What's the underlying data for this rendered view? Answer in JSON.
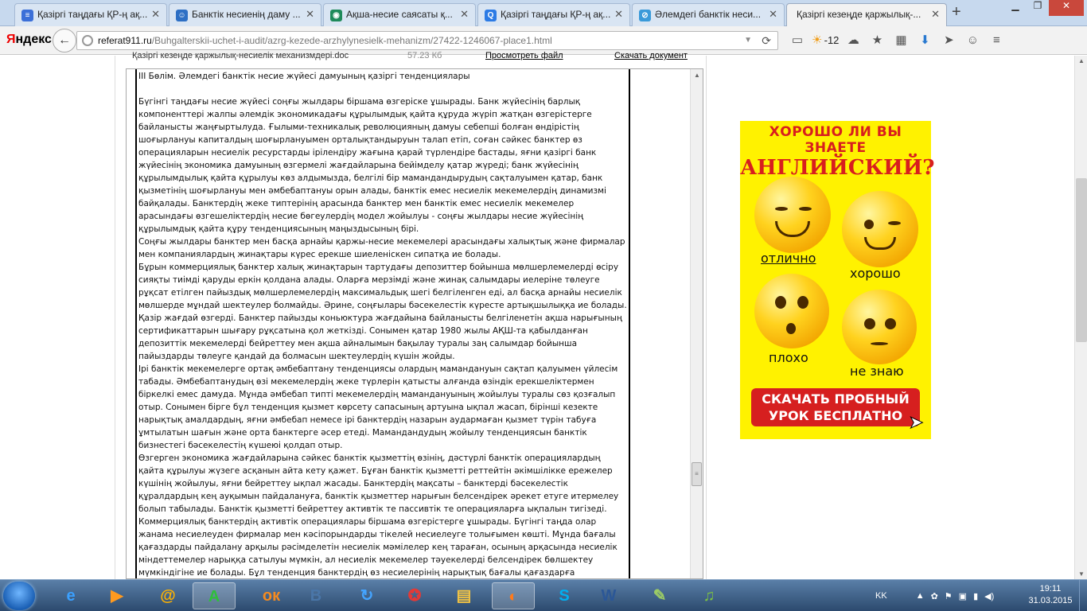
{
  "browser": {
    "tabs": [
      {
        "label": "Қазіргі таңдағы ҚР-ң ақ...",
        "icon_color": "#3b6fd8",
        "icon_glyph": "≡",
        "active": false
      },
      {
        "label": "Банктік несиенің даму ...",
        "icon_color": "#2d6fc4",
        "icon_glyph": "☺",
        "active": false
      },
      {
        "label": "Ақша-несие саясаты қ...",
        "icon_color": "#1e8a5a",
        "icon_glyph": "◉",
        "active": false
      },
      {
        "label": "Қазіргі таңдағы ҚР-ң ақ...",
        "icon_color": "#2c7be5",
        "icon_glyph": "Q",
        "active": false
      },
      {
        "label": "Әлемдегі банктік неси...",
        "icon_color": "#3a9ad9",
        "icon_glyph": "⊘",
        "active": false
      },
      {
        "label": "Қазіргі кезеңде қаржылық-...",
        "icon_color": "#ffffff",
        "icon_glyph": "",
        "active": true
      }
    ],
    "new_tab": "+",
    "logo": {
      "first": "Я",
      "rest": "ндекс"
    },
    "url": {
      "host": "referat911.ru",
      "path": "/Buhgalterskii-uchet-i-audit/azrg-kezede-arzhylynesielk-mehanizm/27422-1246067-place1.html"
    },
    "weather_temp": "-12"
  },
  "file_bar": {
    "name": "Қазіргі кезеңде қаржылық-несиелік механизмдері.doc",
    "size": "57.23 Кб",
    "view": "Просмотреть файл",
    "download": "Скачать документ"
  },
  "document": {
    "heading": "ІІІ Бөлім. Әлемдегі банктік несие жүйесі дамуының қазіргі  тенденциялары",
    "paragraphs": [
      "Бүгінгі таңдағы несие жүйесі соңғы жылдары біршама өзгеріске ұшырады. Банк жүйесінің барлық компоненттері жалпы әлемдік экономикадағы құрылымдық қайта құруда жүріп жатқан өзгерістерге байланысты жаңғыртылуда. Ғылыми-техникалық революцияның дамуы себепші болған өндірістің шоғырлануы капиталдың шоғырлануымен орталықтандыруын талап етіп, соған сәйкес банктер өз операцияларын несиелік ресурстарды ірілендіру жағына қарай түрлендіре бастады, яғни қазіргі банк жүйесінің экономика дамуының өзгермелі жағдайларына бейімделу қатар жүреді; банк жүйесінің құрылымдылық қайта құрылуы көз алдымызда, белгілі бір мамандандырудың сақталуымен қатар, банк қызметінің шоғырлануы мен әмбебаптануы орын алады, банктік емес несиелік мекемелердің динамизмі байқалады. Банктердің жеке типтерінің арасында банктер мен банктік емес несиелік мекемелер арасындағы өзгешеліктердің несие бөгеулердің модел жойылуы - соңғы жылдары несие жүйесінің құрылымдық қайта құру тенденциясының маңыздысының бірі.",
      "Соңғы жылдары банктер мен басқа арнайы қаржы-несие мекемелері арасындағы халықтық және фирмалар мен компаниялардың жинақтары күрес ерекше шиеленіскен сипатқа ие болады.",
      "Бұрын коммерциялық банктер халық жинақтарын тартудағы депозиттер бойынша мөлшерлемелерді өсіру сияқты тиімді қаруды еркін қолдана алады. Оларға мерзімді және жинақ салымдары иелеріне төлеуге рұқсат етілген пайыздық мөлшерлемелердің максимальдық шегі белгіленген еді, ал басқа арнайы несиелік мөлшерде мұндай шектеулер болмайды. Әрине, соңғылары бәсекелестік күресте артықшылыққа ие болады. Қазір жағдай өзгерді. Банктер пайызды коньюктура жағдайына байланысты белгіленетін ақша нарығының сертификаттарын шығару рұқсатына қол жеткізді. Сонымен қатар 1980 жылы АҚШ-та қабылданған депозиттік мекемелерді бейреттеу мен ақша айналымын бақылау туралы заң салымдар бойынша пайыздарды төлеуге қандай да болмасын шектеулердің күшін жойды.",
      "Ірі банктік мекемелерге ортақ әмбебаптану тенденциясы олардың мамандануын сақтап қалуымен үйлесім табады. Әмбебаптанудың өзі мекемелердің жеке түрлерін қатысты алғанда өзіндік ерекшеліктермен біркелкі емес дамуда. Мұнда әмбебап типті мекемелердің мамандануының жойылуы туралы сөз қозғалып отыр. Сонымен бірге бұл тенденция қызмет көрсету сапасының артуына ықпал жасап, біріншi кезекте нарықтық амалдардың, яғни әмбебап немесе ірі банктердің назарын аудармаған қызмет түрін табуға ұмтылатын шағын және орта банктерге әсер етеді. Мамандандудың жойылу тенденциясын банктік бизнестегі бәсекелестің күшеюі қолдап отыр.",
      "Өзгерген экономика жағдайларына сәйкес банктік қызметтің өзінің, дәстүрлі банктік операциялардың қайта құрылуы жүзеге асқанын айта кету қажет. Бұған банктік қызметті реттейтін әкімшілікке ережелер күшінің жойылуы, яғни бейреттеу ықпал жасады. Банктердің мақсаты – банктерді бәсекелестік құралдардың кең ауқымын пайдалануға, банктік қызметтер нарығын белсендірек әрекет етуге итермелеу болып табылады. Банктік қызметті бейреттеу активтік те пассивтік те операцияларға ықпалын тигізеді. Коммерциялық банктердің активтік операциялары біршама өзгерістерге ұшырады. Бүгінгі таңда олар жанама несиелеуден фирмалар мен кәсіпорындарды тікелей несиелеуге толығымен көшті. Мұнда бағалы қағаздарды пайдалану арқылы рәсімделетін несиелік мәмілелер кең тараған, осының арқасында несиелік міндеттемелер нарыққа сатылуы мүмкін, ал несиелік мекемелер тәуекелерді белсендірек бөлшектеу мүмкіндігіне ие болады. Бұл тенденция банктердің өз несиелерінің нарықтық бағалы қағаздарға конвертациялау талпынысында"
    ]
  },
  "ad": {
    "line1": "ХОРОШО ЛИ ВЫ ЗНАЕТЕ",
    "line2": "АНГЛИЙСКИЙ?",
    "captions": [
      "отлично",
      "хорошо",
      "плохо",
      "не знаю"
    ],
    "button_line1": "СКАЧАТЬ ПРОБНЫЙ",
    "button_line2": "УРОК БЕСПЛАТНО",
    "bg_color": "#fff200",
    "accent_color": "#d81e1e"
  },
  "taskbar": {
    "apps": [
      {
        "name": "internet-explorer-icon",
        "glyph": "e",
        "color": "#3aa0ff",
        "active": false
      },
      {
        "name": "media-player-icon",
        "glyph": "▶",
        "color": "#ff9a1f",
        "active": false
      },
      {
        "name": "mail-agent-icon",
        "glyph": "@",
        "color": "#ffb300",
        "active": false
      },
      {
        "name": "activity-icon",
        "glyph": "A",
        "color": "#2fbf3a",
        "active": true
      },
      {
        "name": "odnoklassniki-icon",
        "glyph": "ок",
        "color": "#f58a1f",
        "active": false
      },
      {
        "name": "vk-icon",
        "glyph": "В",
        "color": "#4a76a8",
        "active": false
      },
      {
        "name": "refresh-app-icon",
        "glyph": "↻",
        "color": "#44a4ff",
        "active": false
      },
      {
        "name": "tools-icon",
        "glyph": "✪",
        "color": "#e53935",
        "active": false
      },
      {
        "name": "folder-icon",
        "glyph": "▤",
        "color": "#f5c542",
        "active": false
      },
      {
        "name": "firefox-icon",
        "glyph": "◐",
        "color": "#ff7a1a",
        "active": true
      },
      {
        "name": "skype-icon",
        "glyph": "S",
        "color": "#00aff0",
        "active": false
      },
      {
        "name": "word-icon",
        "glyph": "W",
        "color": "#2b5797",
        "active": false
      },
      {
        "name": "paint-icon",
        "glyph": "✎",
        "color": "#9ccc65",
        "active": false
      },
      {
        "name": "music-icon",
        "glyph": "♫",
        "color": "#7cc242",
        "active": false
      }
    ],
    "lang": "KK",
    "time": "19:11",
    "date": "31.03.2015"
  }
}
